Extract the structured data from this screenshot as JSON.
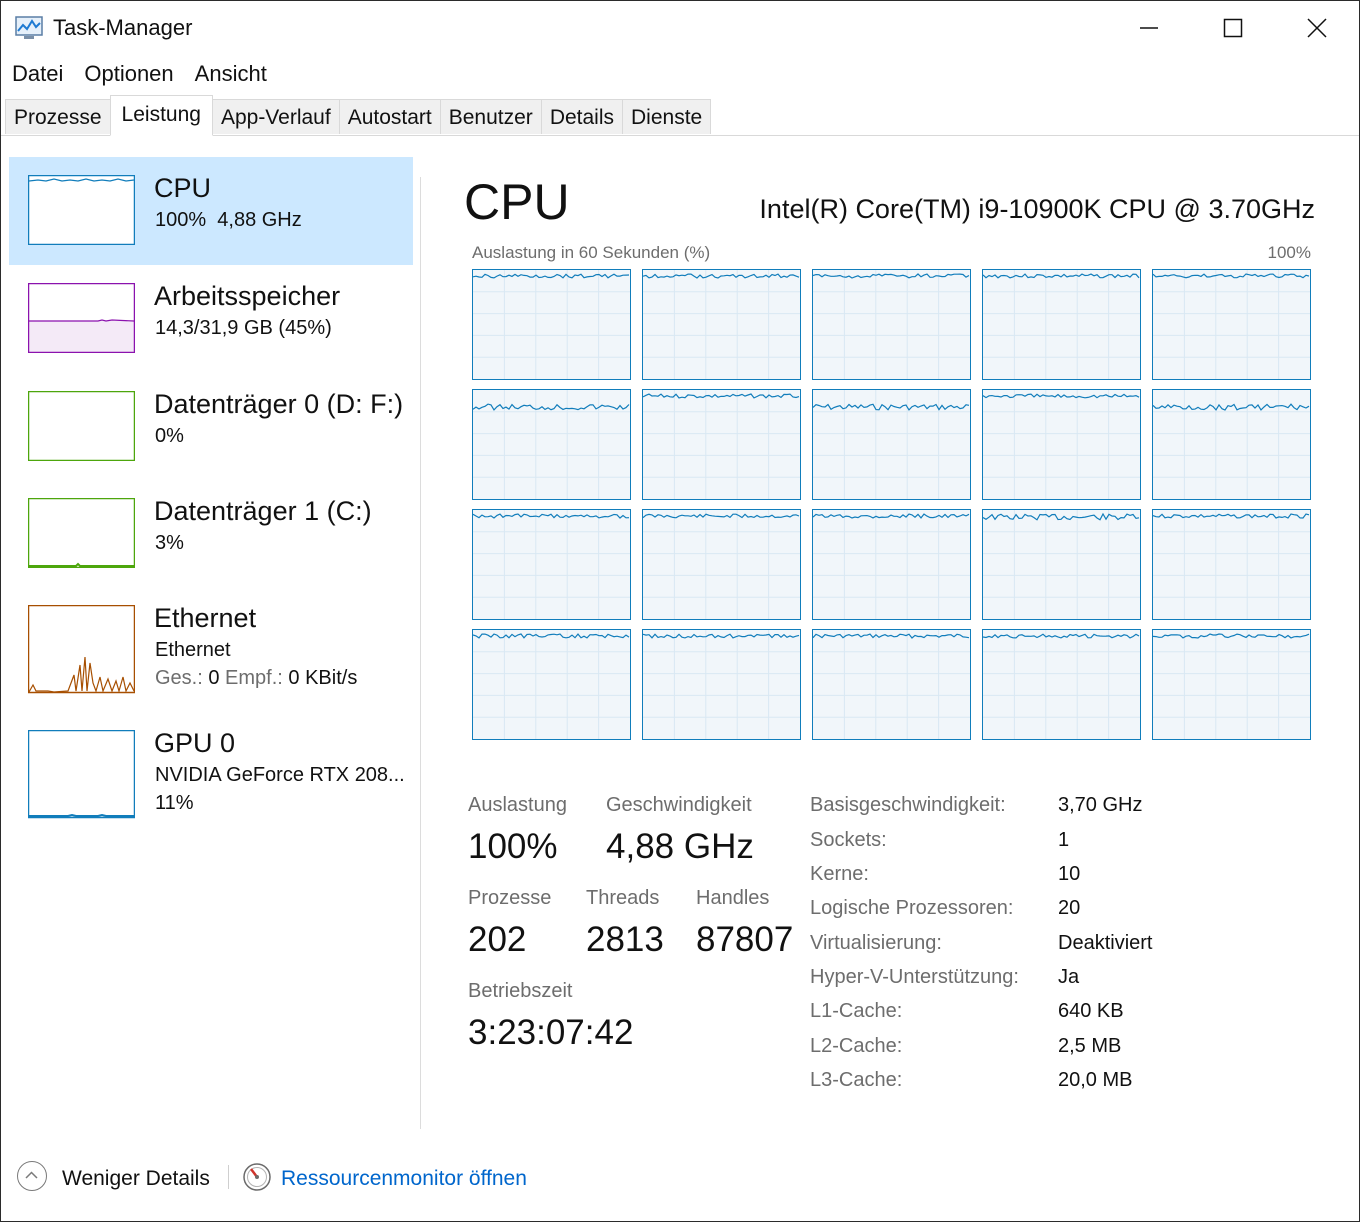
{
  "window": {
    "title": "Task-Manager"
  },
  "menu": [
    {
      "label": "Datei"
    },
    {
      "label": "Optionen"
    },
    {
      "label": "Ansicht"
    }
  ],
  "tabs": [
    {
      "label": "Prozesse",
      "active": false
    },
    {
      "label": "Leistung",
      "active": true
    },
    {
      "label": "App-Verlauf",
      "active": false
    },
    {
      "label": "Autostart",
      "active": false
    },
    {
      "label": "Benutzer",
      "active": false
    },
    {
      "label": "Details",
      "active": false
    },
    {
      "label": "Dienste",
      "active": false
    }
  ],
  "sidebar": {
    "items": [
      {
        "name": "CPU",
        "sub": "100%  4,88 GHz",
        "color": "#117dbb",
        "icon": "cpu-graph-thumbnail",
        "selected": true
      },
      {
        "name": "Arbeitsspeicher",
        "sub": "14,3/31,9 GB (45%)",
        "color": "#8b12ae",
        "icon": "memory-graph-thumbnail"
      },
      {
        "name": "Datenträger 0 (D: F:)",
        "sub": "0%",
        "color": "#4da60c",
        "icon": "disk-graph-thumbnail"
      },
      {
        "name": "Datenträger 1 (C:)",
        "sub": "3%",
        "color": "#4da60c",
        "icon": "disk-graph-thumbnail"
      },
      {
        "name": "Ethernet",
        "sub": "Ethernet",
        "sub2_send_label": "Ges.:",
        "sub2_send_value": "0",
        "sub2_recv_label": "Empf.:",
        "sub2_recv_value": "0 KBit/s",
        "color": "#a74f01",
        "icon": "ethernet-graph-thumbnail"
      },
      {
        "name": "GPU 0",
        "sub": "NVIDIA GeForce RTX 208...",
        "sub2": "11%",
        "color": "#117dbb",
        "icon": "gpu-graph-thumbnail"
      }
    ]
  },
  "main": {
    "title": "CPU",
    "model": "Intel(R) Core(TM) i9-10900K CPU @ 3.70GHz",
    "graph_label": "Auslastung in 60 Sekunden (%)",
    "graph_max": "100%",
    "logical_processor_graphs": 20,
    "stats": {
      "utilization_label": "Auslastung",
      "utilization_value": "100%",
      "speed_label": "Geschwindigkeit",
      "speed_value": "4,88 GHz",
      "processes_label": "Prozesse",
      "processes_value": "202",
      "threads_label": "Threads",
      "threads_value": "2813",
      "handles_label": "Handles",
      "handles_value": "87807",
      "uptime_label": "Betriebszeit",
      "uptime_value": "3:23:07:42"
    },
    "specs": [
      {
        "label": "Basisgeschwindigkeit:",
        "value": "3,70 GHz"
      },
      {
        "label": "Sockets:",
        "value": "1"
      },
      {
        "label": "Kerne:",
        "value": "10"
      },
      {
        "label": "Logische Prozessoren:",
        "value": "20"
      },
      {
        "label": "Virtualisierung:",
        "value": "Deaktiviert"
      },
      {
        "label": "Hyper-V-Unterstützung:",
        "value": "Ja"
      },
      {
        "label": "L1-Cache:",
        "value": "640 KB"
      },
      {
        "label": "L2-Cache:",
        "value": "2,5 MB"
      },
      {
        "label": "L3-Cache:",
        "value": "20,0 MB"
      }
    ]
  },
  "footer": {
    "fewer_details": "Weniger Details",
    "resource_monitor": "Ressourcenmonitor öffnen"
  },
  "colors": {
    "cpu": "#117dbb",
    "memory": "#8b12ae",
    "disk": "#4da60c",
    "ethernet": "#a74f01",
    "selected_bg": "#cce8ff",
    "link": "#0066cc",
    "graph_fill": "#f1f6fa"
  }
}
